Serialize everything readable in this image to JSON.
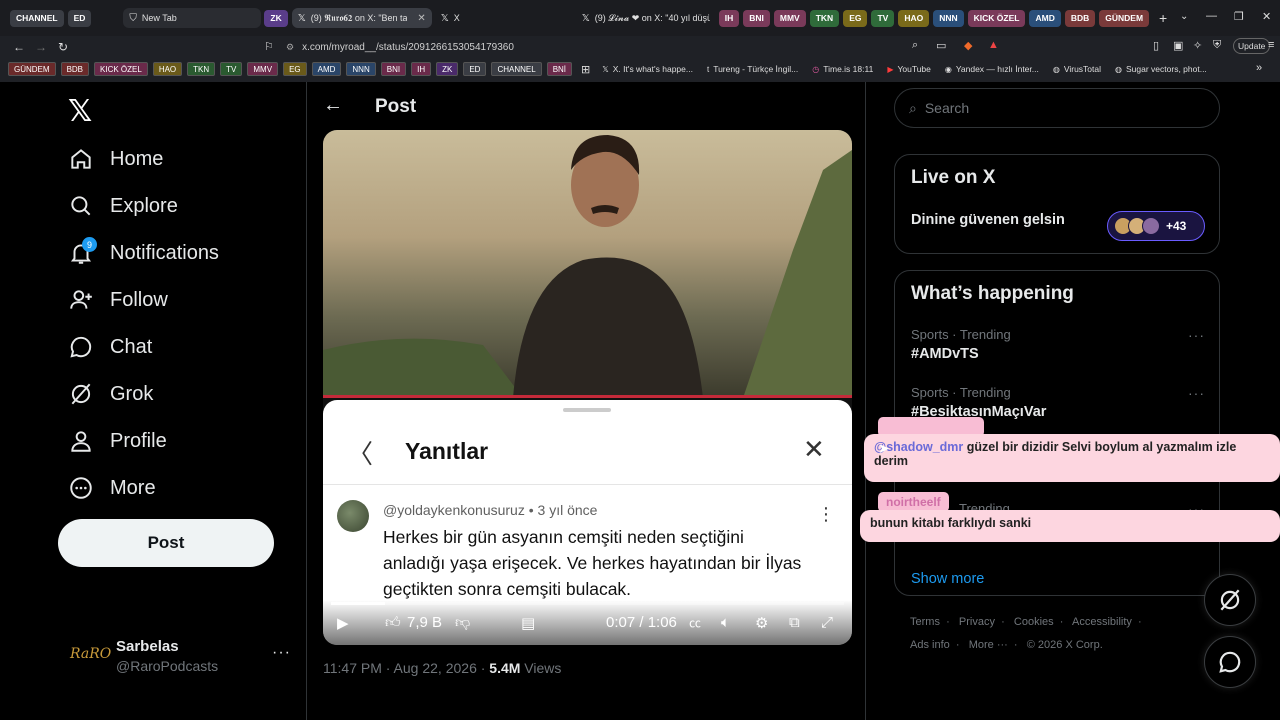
{
  "browser": {
    "tabbar": {
      "left_pills": [
        {
          "label": "CHANNEL",
          "bg": "#3a3d44",
          "fg": "#ffffff"
        },
        {
          "label": "ED",
          "bg": "#3a3d44",
          "fg": "#ffffff"
        }
      ],
      "window_tabs": [
        {
          "title": "New Tab",
          "favicon": "shield-icon",
          "active": false
        },
        {
          "title": "(9) 𝕽𝖚𝖗𝖔𝟔𝟐 on X: \"Ben tamam",
          "favicon": "x-logo-icon",
          "active": true
        },
        {
          "title": "X",
          "favicon": "x-logo-icon",
          "active": false
        },
        {
          "title": "(9) 𝓛𝓲𝓷𝓪 ❤ on X: \"40 yıl düşü",
          "favicon": "x-logo-icon",
          "active": false
        }
      ],
      "right_pills": [
        {
          "label": "ZK",
          "bg": "#5a3d8a",
          "fg": "#ffffff"
        },
        {
          "label": "IH",
          "bg": "#7a3a5a",
          "fg": "#ffffff"
        },
        {
          "label": "BNI",
          "bg": "#7a3a5a",
          "fg": "#ffffff"
        },
        {
          "label": "MMV",
          "bg": "#7a3a5a",
          "fg": "#ffffff"
        },
        {
          "label": "TKN",
          "bg": "#2f6b3a",
          "fg": "#ffffff"
        },
        {
          "label": "EG",
          "bg": "#7a6a1a",
          "fg": "#ffffff"
        },
        {
          "label": "TV",
          "bg": "#2f6b3a",
          "fg": "#ffffff"
        },
        {
          "label": "HAO",
          "bg": "#7a6a1a",
          "fg": "#ffffff"
        },
        {
          "label": "NNN",
          "bg": "#2a4f7a",
          "fg": "#ffffff"
        },
        {
          "label": "KICK ÖZEL",
          "bg": "#7a3a5a",
          "fg": "#ffffff"
        },
        {
          "label": "AMD",
          "bg": "#2a4f7a",
          "fg": "#ffffff"
        },
        {
          "label": "BDB",
          "bg": "#7a3a3a",
          "fg": "#ffffff"
        },
        {
          "label": "GÜNDEM",
          "bg": "#7a3a3a",
          "fg": "#ffffff"
        }
      ]
    },
    "address": {
      "url": "x.com/myroad__/status/2091266153054179360",
      "update_label": "Update"
    },
    "bookmarks": {
      "pills": [
        {
          "label": "GÜNDEM",
          "bg": "#6a2a2a"
        },
        {
          "label": "BDB",
          "bg": "#6a2a2a"
        },
        {
          "label": "KICK ÖZEL",
          "bg": "#6a2a4a"
        },
        {
          "label": "HAO",
          "bg": "#6a5a1a"
        },
        {
          "label": "TKN",
          "bg": "#2a5a30"
        },
        {
          "label": "TV",
          "bg": "#2a5a30"
        },
        {
          "label": "MMV",
          "bg": "#6a2a4a"
        },
        {
          "label": "EG",
          "bg": "#6a5a1a"
        },
        {
          "label": "AMD",
          "bg": "#2a4568"
        },
        {
          "label": "NNN",
          "bg": "#2a4568"
        },
        {
          "label": "BNI",
          "bg": "#6a2a4a"
        },
        {
          "label": "IH",
          "bg": "#6a2a4a"
        },
        {
          "label": "ZK",
          "bg": "#4a2a6a"
        },
        {
          "label": "ED",
          "bg": "#3a3d44"
        },
        {
          "label": "CHANNEL",
          "bg": "#3a3d44"
        },
        {
          "label": "BNİ",
          "bg": "#6a2a4a"
        }
      ],
      "links": [
        {
          "label": "X. It's what's happe...",
          "icon": "x-logo-icon"
        },
        {
          "label": "Tureng - Türkçe İngil...",
          "icon": "tureng-icon"
        },
        {
          "label": "Time.is 18:11",
          "icon": "clock-icon"
        },
        {
          "label": "YouTube",
          "icon": "youtube-icon"
        },
        {
          "label": "Yandex — hızlı İnter...",
          "icon": "yandex-icon"
        },
        {
          "label": "VirusTotal",
          "icon": "globe-icon"
        },
        {
          "label": "Sugar vectors, phot...",
          "icon": "globe-icon"
        }
      ]
    }
  },
  "sidebar": {
    "nav": [
      {
        "label": "Home",
        "icon": "home-icon"
      },
      {
        "label": "Explore",
        "icon": "search-icon"
      },
      {
        "label": "Notifications",
        "icon": "bell-icon",
        "badge": "9"
      },
      {
        "label": "Follow",
        "icon": "follow-icon"
      },
      {
        "label": "Chat",
        "icon": "chat-icon"
      },
      {
        "label": "Grok",
        "icon": "grok-icon"
      },
      {
        "label": "Profile",
        "icon": "profile-icon"
      },
      {
        "label": "More",
        "icon": "more-circle-icon"
      }
    ],
    "post_button": "Post",
    "account": {
      "avatar_text": "RaRO",
      "name": "Sarbelas",
      "handle": "@RaroPodcasts"
    }
  },
  "main": {
    "header": "Post",
    "video": {
      "sheet_title": "Yanıtlar",
      "comment_handle": "@yoldaykenkonusuruz",
      "comment_age": "• 3 yıl önce",
      "comment_text": "Herkes bir gün asyanın cemşiti neden seçtiğini anladığı yaşa erişecek. Ve herkes  hayatından bir İlyas geçtikten sonra cemşiti bulacak.",
      "likes": "7,9 B",
      "time": "0:07 / 1:06",
      "progress": 0.106
    },
    "meta": {
      "timestamp": "11:47 PM · Aug 22, 2026 · ",
      "views_count": "5.4M",
      "views_label": " Views"
    }
  },
  "right": {
    "search_placeholder": "Search",
    "live": {
      "title": "Live on X",
      "space_title": "Dinine güvenen gelsin",
      "listener_count": "+43"
    },
    "happening": {
      "title": "What’s happening",
      "trends": [
        {
          "category": "Sports · Trending",
          "name": "#AMDvTS"
        },
        {
          "category": "Sports · Trending",
          "name": "#BesiktasınMaçıVar"
        },
        {
          "category": "Trending",
          "name": ""
        }
      ],
      "show_more": "Show more"
    },
    "footer": {
      "line1": [
        "Terms",
        "Privacy",
        "Cookies",
        "Accessibility"
      ],
      "line2": [
        "Ads info",
        "More ···",
        "© 2026 X Corp."
      ]
    }
  },
  "overlay_chat": [
    {
      "user": "@shadow_dmr",
      "message": "güzel bir dizidir Selvi boylum al yazmalım izle derim",
      "name_tag": ""
    },
    {
      "user": "",
      "message": "bunun kitabı farklıydı sanki",
      "name_tag": "noirtheelf"
    }
  ]
}
